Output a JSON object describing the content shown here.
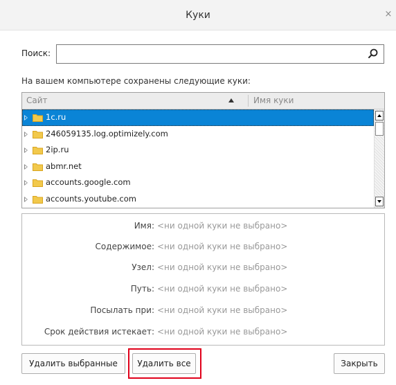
{
  "window": {
    "title": "Куки",
    "close_glyph": "×"
  },
  "search": {
    "label": "Поиск:",
    "value": "",
    "placeholder": ""
  },
  "info_text": "На вашем компьютере сохранены следующие куки:",
  "table": {
    "columns": [
      {
        "label": "Сайт",
        "sorted": "ascending"
      },
      {
        "label": "Имя куки"
      }
    ],
    "rows": [
      {
        "site": "1c.ru",
        "selected": true
      },
      {
        "site": "246059135.log.optimizely.com",
        "selected": false
      },
      {
        "site": "2ip.ru",
        "selected": false
      },
      {
        "site": "abmr.net",
        "selected": false
      },
      {
        "site": "accounts.google.com",
        "selected": false
      },
      {
        "site": "accounts.youtube.com",
        "selected": false
      }
    ]
  },
  "details": [
    {
      "label": "Имя:",
      "value": "<ни одной куки не выбрано>"
    },
    {
      "label": "Содержимое:",
      "value": "<ни одной куки не выбрано>"
    },
    {
      "label": "Узел:",
      "value": "<ни одной куки не выбрано>"
    },
    {
      "label": "Путь:",
      "value": "<ни одной куки не выбрано>"
    },
    {
      "label": "Посылать при:",
      "value": "<ни одной куки не выбрано>"
    },
    {
      "label": "Срок действия истекает:",
      "value": "<ни одной куки не выбрано>"
    }
  ],
  "buttons": {
    "remove_selected": "Удалить выбранные",
    "remove_all": "Удалить все",
    "close": "Закрыть"
  },
  "colors": {
    "selection": "#0a84d6",
    "folder": "#f2c94c",
    "highlight": "#e0001a"
  }
}
